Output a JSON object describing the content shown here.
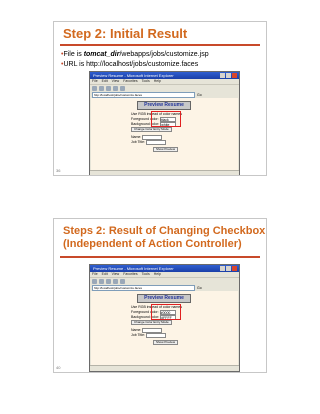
{
  "slides": [
    {
      "title": "Step 2: Initial Result",
      "bullets": [
        {
          "prefix": "File is ",
          "em": "tomcat_dir",
          "suffix": "/webapps/jobs/customize.jsp"
        },
        {
          "prefix": "URL is http://localhost/jobs/customize.faces",
          "em": "",
          "suffix": ""
        }
      ],
      "number": "36",
      "browser": {
        "title": "Preview Resume - Microsoft Internet Explorer",
        "menu": [
          "File",
          "Edit",
          "View",
          "Favorites",
          "Tools",
          "Help"
        ],
        "address": "http://localhost/jobs/customize.faces",
        "go": "Go",
        "preview_title": "Preview Resume",
        "checkbox_label": "Use RGB instead of color names",
        "fg_label": "Foreground color:",
        "fg_value": "black",
        "bg_label": "Background color:",
        "bg_value": "white",
        "change_btn": "Change Color Entry Mode",
        "name_label": "Name:",
        "title_label": "Job Title:",
        "show_btn": "Show Preview"
      }
    },
    {
      "title_line1": "Steps 2: Result of Changing Checkbox",
      "title_line2": "(Independent of Action Controller)",
      "number": "40",
      "browser": {
        "title": "Preview Resume - Microsoft Internet Explorer",
        "menu": [
          "File",
          "Edit",
          "View",
          "Favorites",
          "Tools",
          "Help"
        ],
        "address": "http://localhost/jobs/customize.faces",
        "go": "Go",
        "preview_title": "Preview Resume",
        "checkbox_label": "Use RGB instead of color names",
        "fg_label": "Foreground color:",
        "fg_value": "#0000",
        "bg_label": "Background color:",
        "bg_value": "#FFFF",
        "change_btn": "Change Color Entry Mode",
        "name_label": "Name:",
        "title_label": "Job Title:",
        "show_btn": "Show Preview"
      }
    }
  ]
}
